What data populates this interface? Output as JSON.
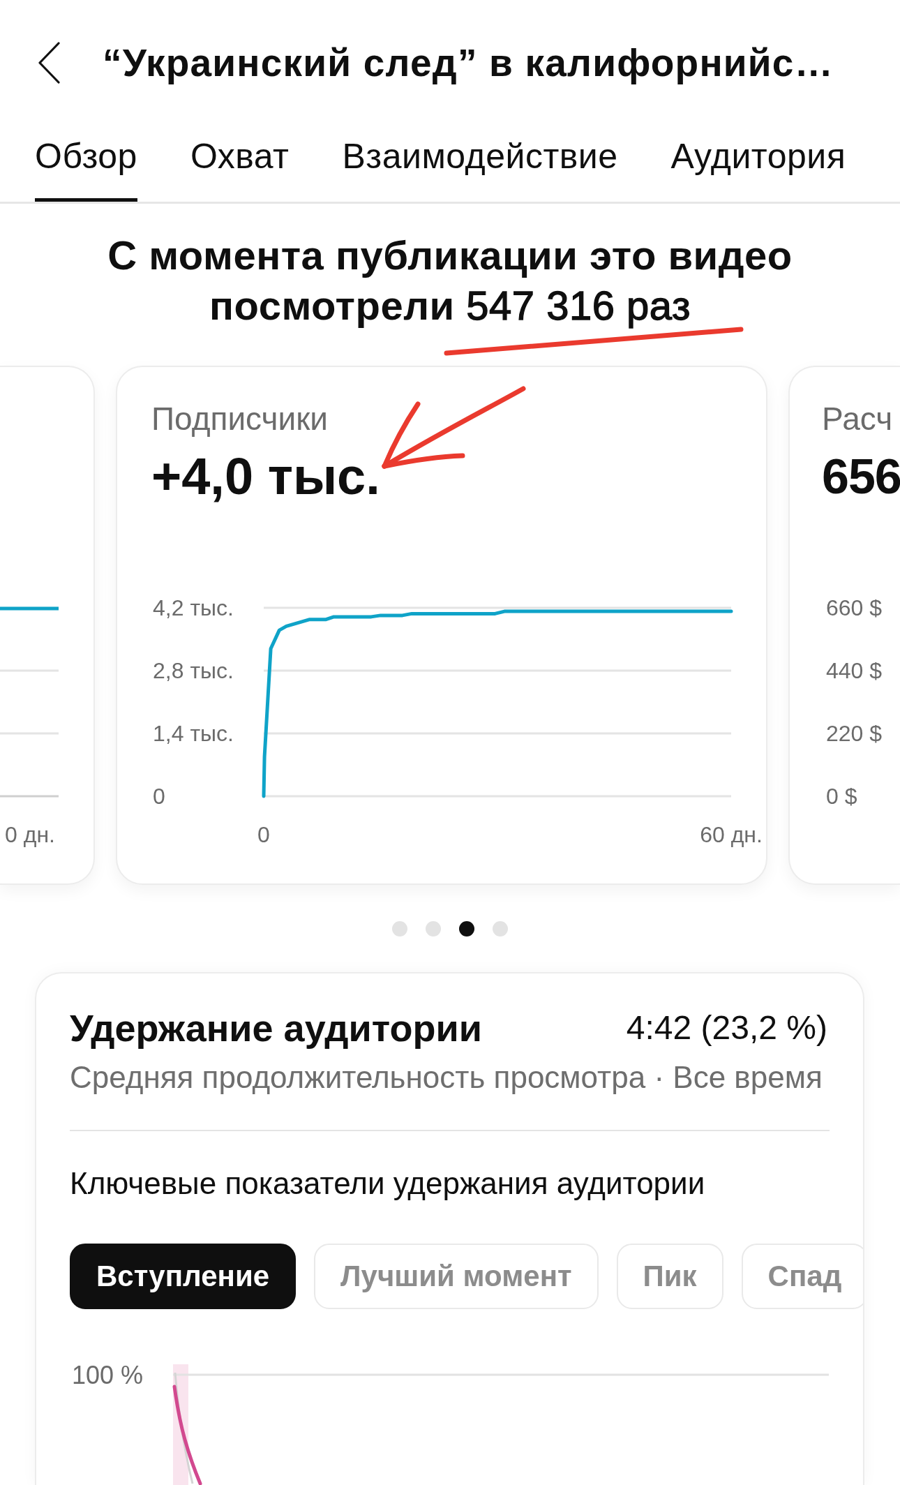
{
  "header": {
    "title": "“Украинский след” в калифорнийс…"
  },
  "tabs": [
    {
      "label": "Обзор",
      "selected": true
    },
    {
      "label": "Охват",
      "selected": false
    },
    {
      "label": "Взаимодействие",
      "selected": false
    },
    {
      "label": "Аудитория",
      "selected": false
    }
  ],
  "summary": {
    "text": "**С момента публикации это видео посмотрели** 547 316 раз"
  },
  "metric_cards": [
    {
      "kind": "partial_left",
      "x_axis_labels": [
        "0 дн."
      ]
    },
    {
      "kind": "full",
      "label": "Подписчики",
      "value": "+4,0 тыс.",
      "chart_data": {
        "type": "line",
        "x": [
          0,
          0.1,
          0.9,
          2,
          2.9,
          5.9,
          8,
          9,
          13.8,
          15,
          17.8,
          19,
          29.7,
          30.9,
          60
        ],
        "series": [
          {
            "color": "#0fa3c8",
            "values": [
              0,
              0.88,
              3.29,
              3.7,
              3.79,
              3.94,
              3.94,
              4.0,
              4.0,
              4.03,
              4.03,
              4.07,
              4.07,
              4.12,
              4.12
            ]
          }
        ],
        "xlim": [
          0,
          60
        ],
        "ylim": [
          0,
          4.2
        ],
        "xticks": [
          {
            "value": 0,
            "label": "0"
          },
          {
            "value": 60,
            "label": "60 дн."
          }
        ],
        "yticks": [
          {
            "value": 0,
            "label": "0"
          },
          {
            "value": 1.4,
            "label": "1,4 тыс."
          },
          {
            "value": 2.8,
            "label": "2,8 тыс."
          },
          {
            "value": 4.2,
            "label": "4,2 тыс."
          }
        ]
      }
    },
    {
      "kind": "partial_right",
      "label": "Расч",
      "value": "656",
      "y_axis_labels": [
        "660 $",
        "440 $",
        "220 $",
        "0 $"
      ]
    }
  ],
  "carousel_dots": [
    {
      "selected": false
    },
    {
      "selected": false
    },
    {
      "selected": true
    },
    {
      "selected": false
    }
  ],
  "retention": {
    "title": "Удержание аудитории",
    "value": "4:42 (23,2 %)",
    "subtitle": "Средняя продолжительность просмотра · Все время",
    "key_moments_label": "Ключевые показатели удержания аудитории",
    "chips": [
      {
        "label": "Вступление",
        "selected": true
      },
      {
        "label": "Лучший момент",
        "selected": false
      },
      {
        "label": "Пик",
        "selected": false
      },
      {
        "label": "Спад",
        "selected": false
      }
    ],
    "chart": {
      "y_axis_labels": [
        "100 %"
      ]
    }
  }
}
